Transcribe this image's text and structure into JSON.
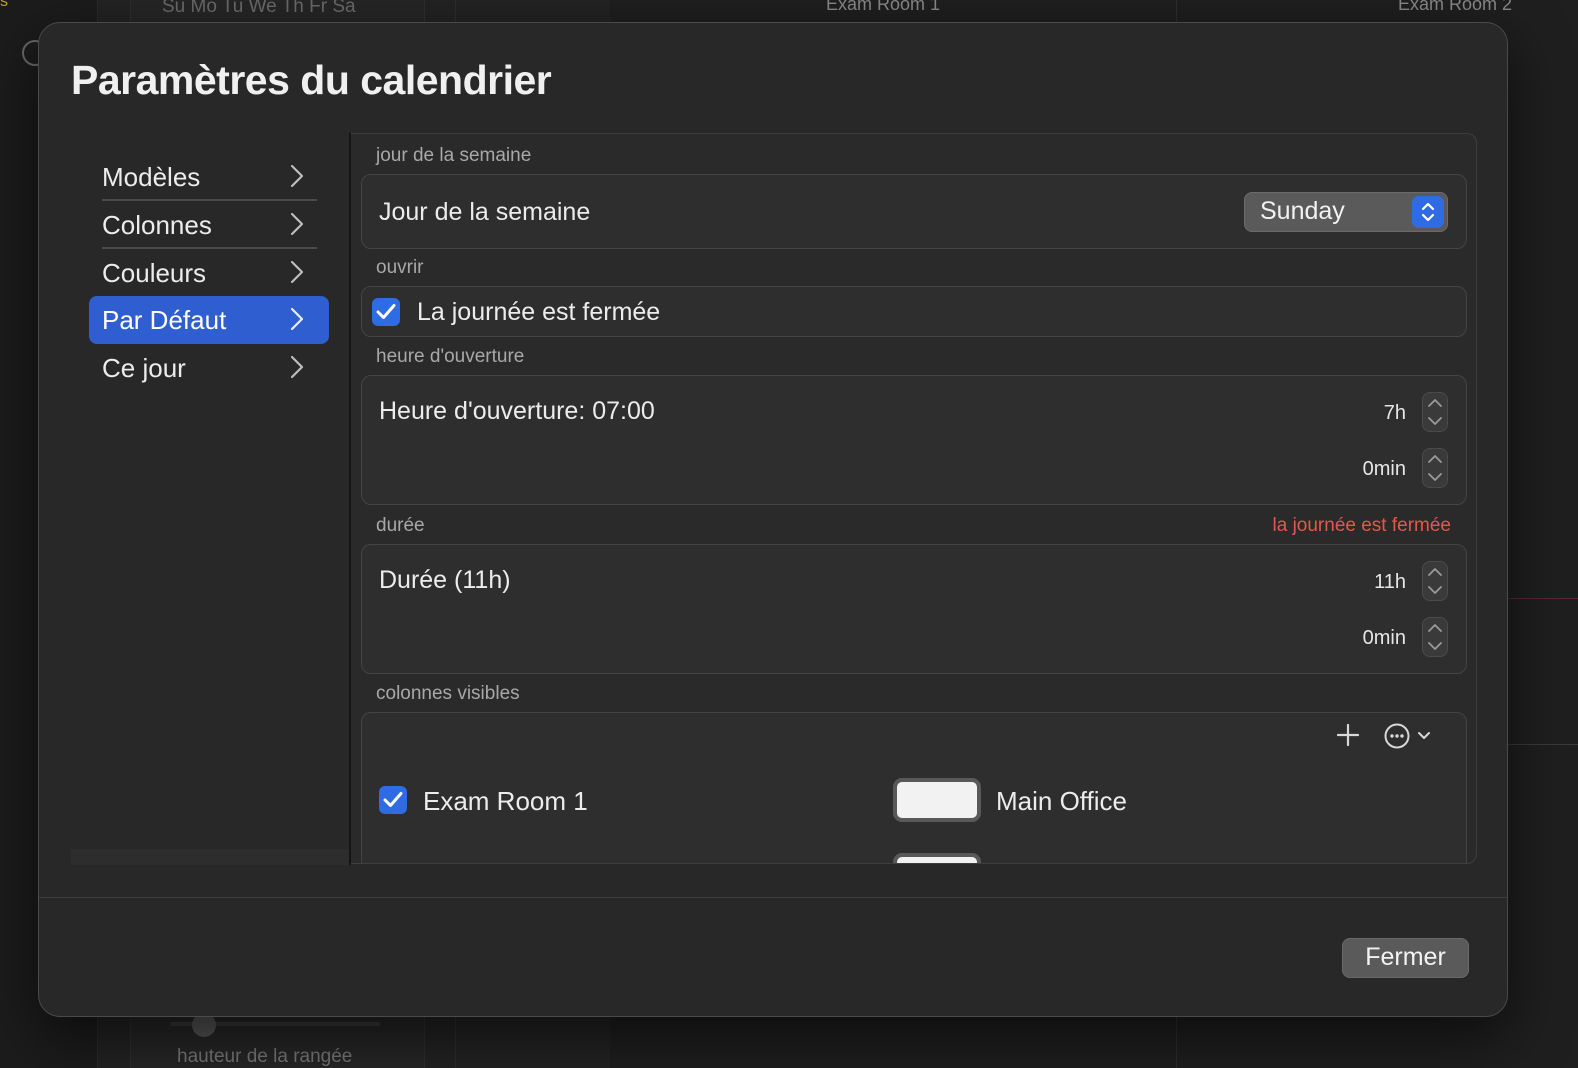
{
  "background": {
    "weekday_header": "Su Mo Tu We Th Fr Sa",
    "column_1": "Exam Room 1",
    "column_2": "Exam Room 2",
    "bottom_label": "hauteur de la rangée",
    "corner_text": "s"
  },
  "dialog": {
    "title": "Paramètres du calendrier",
    "sidebar": {
      "items": [
        {
          "label": "Modèles"
        },
        {
          "label": "Colonnes"
        },
        {
          "label": "Couleurs"
        },
        {
          "label": "Par Défaut",
          "active": true
        },
        {
          "label": "Ce jour"
        }
      ]
    },
    "weekday_section": {
      "header": "jour de la semaine",
      "label": "Jour de la semaine",
      "selected": "Sunday"
    },
    "open_section": {
      "header": "ouvrir",
      "checkbox_label": "La journée est fermée",
      "checked": true
    },
    "opening_section": {
      "header": "heure d'ouverture",
      "label": "Heure d'ouverture: 07:00",
      "hours": "7h",
      "minutes": "0min"
    },
    "duration_section": {
      "header": "durée",
      "warning": "la journée est fermée",
      "label": "Durée (11h)",
      "hours": "11h",
      "minutes": "0min"
    },
    "columns_section": {
      "header": "colonnes visibles",
      "rows": [
        {
          "name": "Exam Room 1",
          "checked": true,
          "location": "Main Office",
          "swatch_color": "#f2f2f2"
        }
      ]
    },
    "close_button": "Fermer"
  },
  "colors": {
    "accent": "#2f6be2",
    "sidebar_active": "#2f5ed1",
    "warning": "#e4574b",
    "dialog_bg": "#282828"
  }
}
